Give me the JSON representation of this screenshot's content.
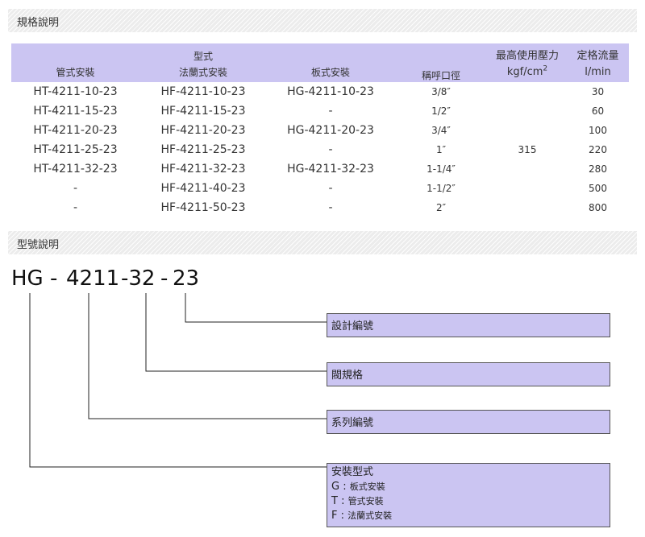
{
  "sections": {
    "spec_title": "規格說明",
    "model_title": "型號說明"
  },
  "table": {
    "type_header": "型式",
    "col_pipe": "管式安裝",
    "col_flange": "法蘭式安裝",
    "col_plate": "板式安裝",
    "col_size": "稱呼口徑",
    "col_pressure_line1": "最高使用壓力",
    "col_pressure_unit": "kgf/cm",
    "col_pressure_sup": "2",
    "col_flow_line1": "定格流量",
    "col_flow_unit": "l/min",
    "pressure_value": "315",
    "rows": [
      {
        "pipe": "HT-4211-10-23",
        "flange": "HF-4211-10-23",
        "plate": "HG-4211-10-23",
        "size": "3/8″",
        "flow": "30"
      },
      {
        "pipe": "HT-4211-15-23",
        "flange": "HF-4211-15-23",
        "plate": "-",
        "size": "1/2″",
        "flow": "60"
      },
      {
        "pipe": "HT-4211-20-23",
        "flange": "HF-4211-20-23",
        "plate": "HG-4211-20-23",
        "size": "3/4″",
        "flow": "100"
      },
      {
        "pipe": "HT-4211-25-23",
        "flange": "HF-4211-25-23",
        "plate": "-",
        "size": "1″",
        "flow": "220"
      },
      {
        "pipe": "HT-4211-32-23",
        "flange": "HF-4211-32-23",
        "plate": "HG-4211-32-23",
        "size": "1-1/4″",
        "flow": "280"
      },
      {
        "pipe": "-",
        "flange": "HF-4211-40-23",
        "plate": "-",
        "size": "1-1/2″",
        "flow": "500"
      },
      {
        "pipe": "-",
        "flange": "HF-4211-50-23",
        "plate": "-",
        "size": "2″",
        "flow": "800"
      }
    ]
  },
  "model": {
    "part_series": "HG -",
    "part_code": "4211",
    "part_size": "-32",
    "part_dash": "-",
    "part_design": "23",
    "box_design": "設計編號",
    "box_size": "閥規格",
    "box_series": "系列編號",
    "box_install_title": "安裝型式",
    "install_options": [
      {
        "letter": "G",
        "sep": " : ",
        "desc": "板式安裝"
      },
      {
        "letter": "T",
        "sep": " : ",
        "desc": "管式安裝"
      },
      {
        "letter": "F",
        "sep": " : ",
        "desc": "法蘭式安裝"
      }
    ]
  },
  "colors": {
    "header_bg": "#cbc5f2",
    "box_bg": "#cbc5f2",
    "line": "#222222"
  }
}
